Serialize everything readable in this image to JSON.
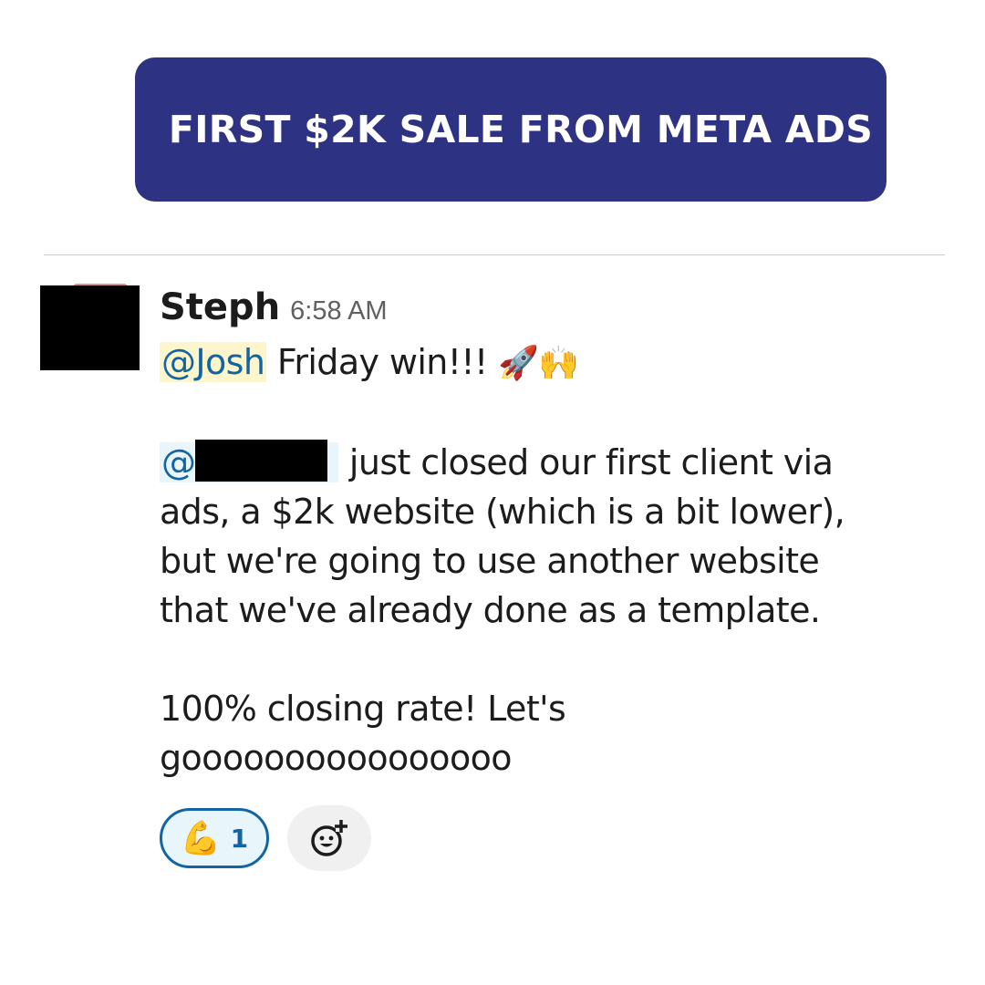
{
  "banner": {
    "title": "FIRST $2K SALE FROM META ADS"
  },
  "message": {
    "sender": "Steph",
    "time": "6:58 AM",
    "line1": {
      "mention": "@Josh",
      "text": " Friday win!!! ",
      "emojis": "🚀🙌"
    },
    "para2": {
      "mention_prefix": "@",
      "first_line_rest": " just closed our first client via",
      "line2": "ads, a $2k website (which is a bit lower),",
      "line3": "but we're going to use another website",
      "line4": "that we've already done as a template."
    },
    "para3": {
      "line1": "100% closing rate! Let's",
      "line2": "goooooooooooooooo"
    }
  },
  "reactions": [
    {
      "emoji": "💪",
      "count": "1"
    }
  ],
  "add_reaction_icon": "add-emoji-icon",
  "colors": {
    "banner": "#2d3283",
    "mention": "#1264a3",
    "mention_bg": "#fdf5cc",
    "reaction_border": "#1264a3"
  }
}
